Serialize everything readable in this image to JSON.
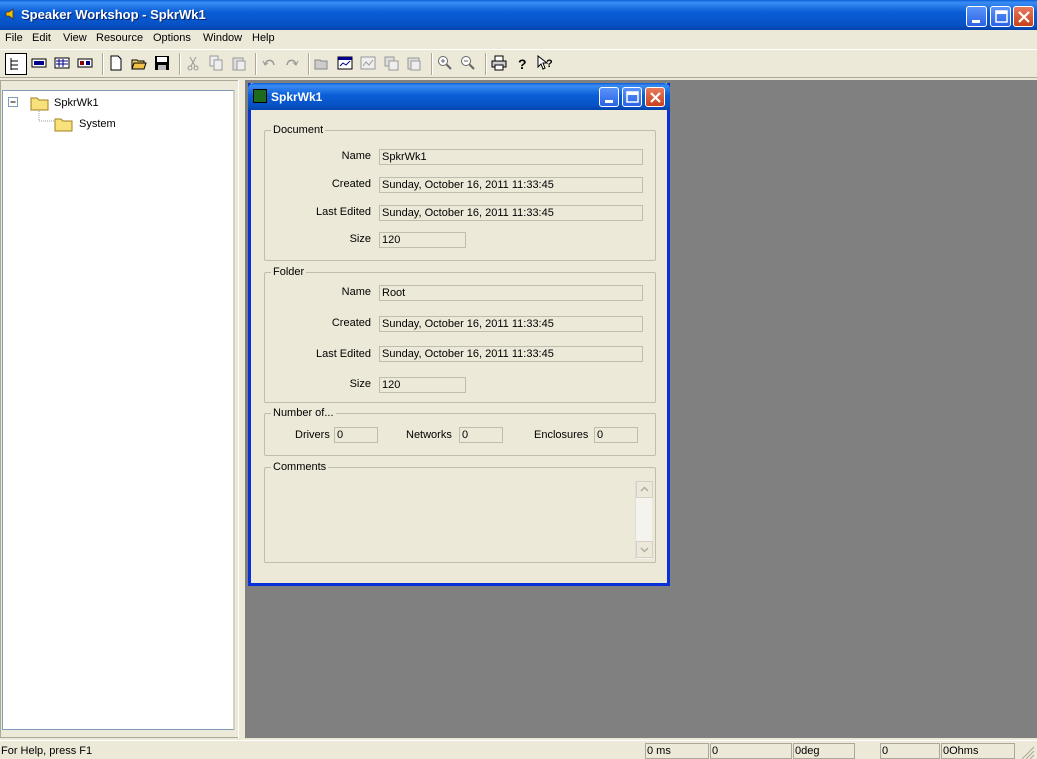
{
  "app": {
    "title": "Speaker Workshop - SpkrWk1"
  },
  "menu": [
    "File",
    "Edit",
    "View",
    "Resource",
    "Options",
    "Window",
    "Help"
  ],
  "toolbar": {
    "buttons": [
      "tree-view",
      "driver",
      "network",
      "enclosure",
      "new",
      "open",
      "save",
      "cut",
      "copy",
      "paste",
      "undo",
      "redo",
      "open-folder",
      "chart",
      "chart-alt",
      "copy-chart",
      "paste-chart",
      "zoom-in",
      "zoom-out",
      "print",
      "help",
      "context-help"
    ]
  },
  "tree": {
    "root": "SpkrWk1",
    "children": [
      "System"
    ]
  },
  "child_window": {
    "title": "SpkrWk1",
    "document": {
      "group_label": "Document",
      "name_label": "Name",
      "name_value": "SpkrWk1",
      "created_label": "Created",
      "created_value": "Sunday, October 16, 2011 11:33:45",
      "edited_label": "Last Edited",
      "edited_value": "Sunday, October 16, 2011 11:33:45",
      "size_label": "Size",
      "size_value": "120"
    },
    "folder": {
      "group_label": "Folder",
      "name_label": "Name",
      "name_value": "Root",
      "created_label": "Created",
      "created_value": "Sunday, October 16, 2011 11:33:45",
      "edited_label": "Last Edited",
      "edited_value": "Sunday, October 16, 2011 11:33:45",
      "size_label": "Size",
      "size_value": "120"
    },
    "counts": {
      "group_label": "Number of...",
      "drivers_label": "Drivers",
      "drivers_value": "0",
      "networks_label": "Networks",
      "networks_value": "0",
      "enclosures_label": "Enclosures",
      "enclosures_value": "0"
    },
    "comments": {
      "group_label": "Comments"
    }
  },
  "statusbar": {
    "help_text": "For Help, press F1",
    "panels": [
      "0 ms",
      "0",
      "0deg",
      "0",
      "0Ohms"
    ]
  },
  "colors": {
    "titlebar": "#0a5fd8",
    "face": "#ece9d8",
    "mdi_background": "#808080",
    "close_button": "#c8401a"
  }
}
